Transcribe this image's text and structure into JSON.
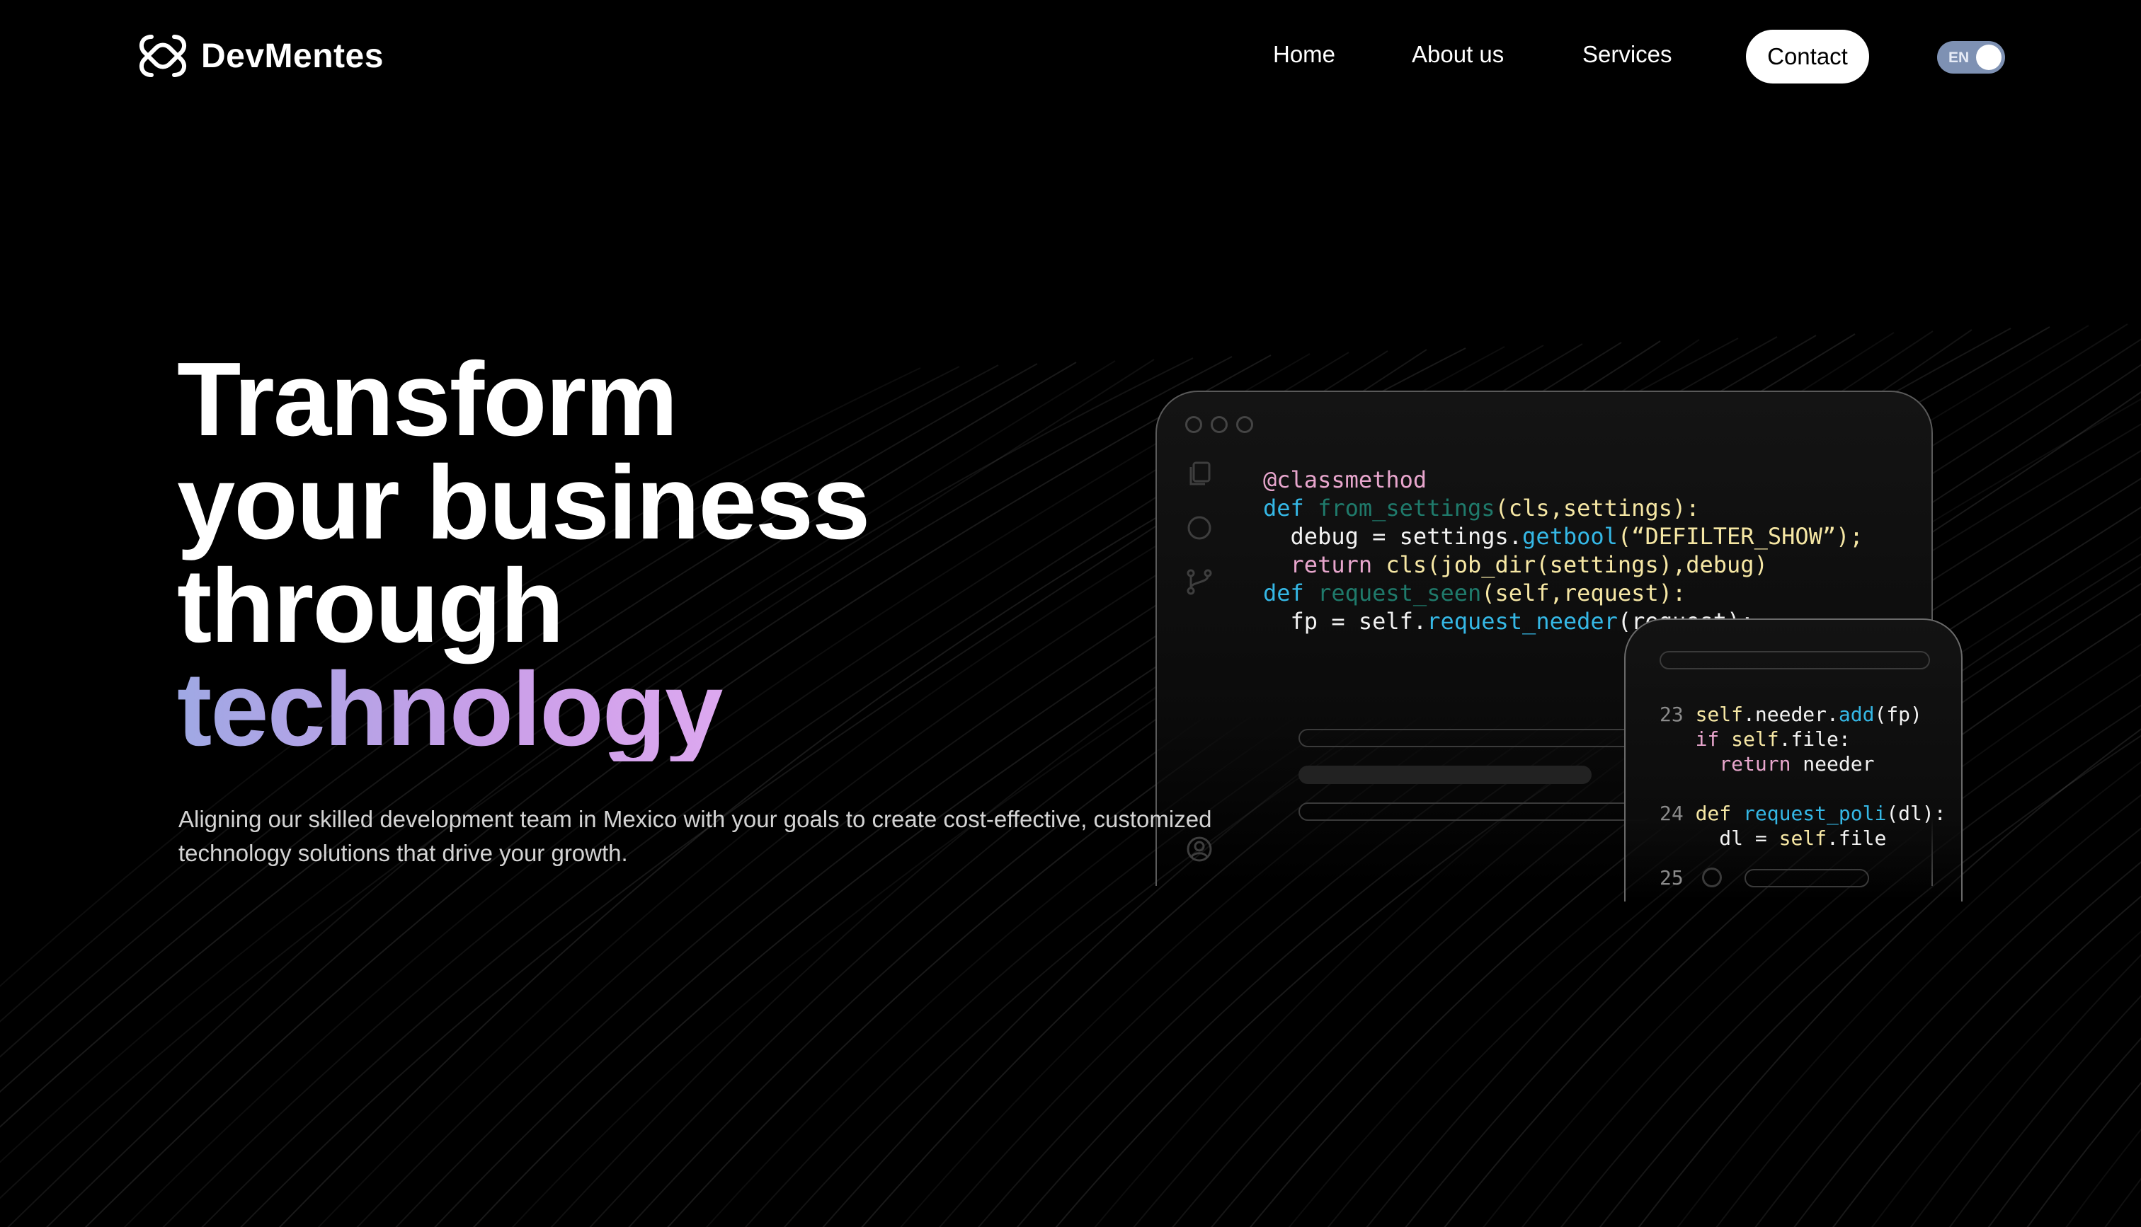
{
  "brand": {
    "name": "DevMentes"
  },
  "nav": {
    "links": [
      {
        "label": "Home"
      },
      {
        "label": "About us"
      },
      {
        "label": "Services"
      }
    ],
    "contact_label": "Contact",
    "language": {
      "label": "EN",
      "toggle_on": true
    }
  },
  "hero": {
    "title_lines": [
      "Transform",
      "your business",
      "through"
    ],
    "title_highlight": "technology",
    "subtitle": "Aligning our skilled development team in Mexico with your goals to create cost-effective, customized technology solutions that drive your growth."
  },
  "code_main": {
    "lines": [
      "@classmethod",
      "def from_settings(cls,settings):",
      "  debug = settings.getbool(“DEFILTER_SHOW”);",
      "  return cls(job_dir(settings),debug)",
      "def request_seen(self,request):",
      "  fp = self.request_needer(request);"
    ],
    "sidebar_icons": [
      "files-icon",
      "search-icon",
      "git-branch-icon",
      "account-icon"
    ]
  },
  "code_secondary": {
    "line_numbers": [
      "23",
      "24",
      "25"
    ],
    "lines": [
      "self.needer.add(fp)",
      "if self.file:",
      "  return needer",
      "def request_poli(dl):",
      "  dl = self.file"
    ]
  },
  "colors": {
    "background": "#000000",
    "gradient_start": "#9fa8e4",
    "gradient_end": "#e9aef4",
    "toggle": "#7e91b3",
    "code_keyword": "#35b8e6",
    "code_decorator": "#e8a6cd",
    "code_function": "#1f7a6b",
    "code_param": "#f6e7a4"
  }
}
